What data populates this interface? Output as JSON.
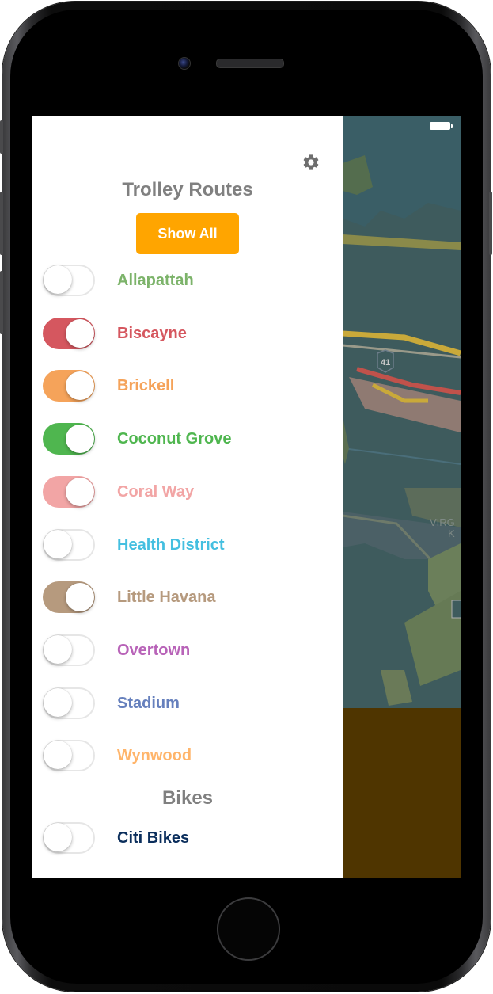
{
  "status_bar": {
    "battery_level": 1.0
  },
  "drawer": {
    "settings_icon": "gear-icon",
    "trolley_title": "Trolley Routes",
    "show_all_label": "Show All",
    "routes": [
      {
        "label": "Allapattah",
        "color": "#7cb36a",
        "on": false
      },
      {
        "label": "Biscayne",
        "color": "#d5575f",
        "on": true
      },
      {
        "label": "Brickell",
        "color": "#f5a35a",
        "on": true
      },
      {
        "label": "Coconut Grove",
        "color": "#4fb64f",
        "on": true
      },
      {
        "label": "Coral Way",
        "color": "#f2a5a5",
        "on": true
      },
      {
        "label": "Health District",
        "color": "#44bfe0",
        "on": false
      },
      {
        "label": "Little Havana",
        "color": "#b69a7e",
        "on": true
      },
      {
        "label": "Overtown",
        "color": "#b863b8",
        "on": false
      },
      {
        "label": "Stadium",
        "color": "#6680bd",
        "on": false
      },
      {
        "label": "Wynwood",
        "color": "#ffb56b",
        "on": false
      }
    ],
    "bikes_title": "Bikes",
    "bikes": [
      {
        "label": "Citi Bikes",
        "color": "#0b2e5c",
        "on": false
      }
    ]
  },
  "map": {
    "highway_shield": "41",
    "place_label_1": "VIRG",
    "place_label_2": "K"
  }
}
